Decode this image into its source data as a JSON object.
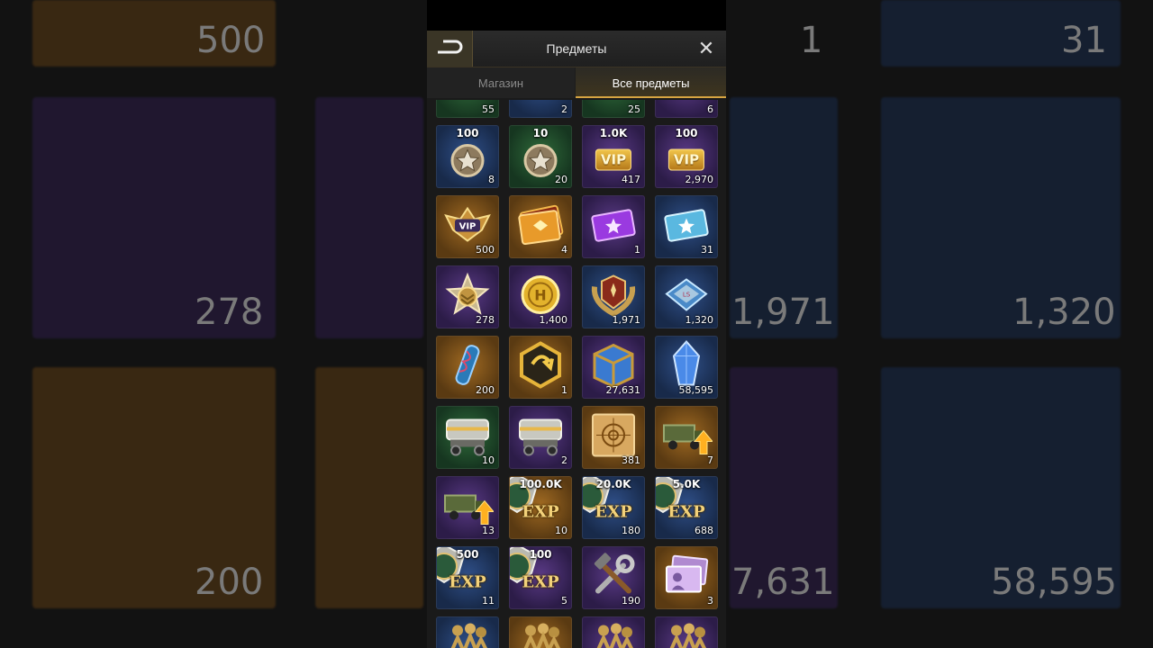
{
  "header": {
    "title": "Предметы",
    "back_icon": "back-arrow-icon",
    "close_icon": "close-icon"
  },
  "tabs": [
    {
      "label": "Магазин",
      "active": false
    },
    {
      "label": "Все предметы",
      "active": true
    }
  ],
  "colors": {
    "accent": "#d7a542",
    "rarity_green": "#2f6a3a",
    "rarity_blue": "#2f4f88",
    "rarity_purple": "#5a3a86",
    "rarity_orange": "#a06a22"
  },
  "partial_top_row": [
    {
      "count": "55",
      "rarity": "green"
    },
    {
      "count": "2",
      "rarity": "blue"
    },
    {
      "count": "25",
      "rarity": "green"
    },
    {
      "count": "6",
      "rarity": "purple"
    }
  ],
  "items": [
    {
      "icon": "star-medal-icon",
      "badge": "100",
      "count": "8",
      "rarity": "blue"
    },
    {
      "icon": "star-medal-icon",
      "badge": "10",
      "count": "20",
      "rarity": "green"
    },
    {
      "icon": "vip-card-icon",
      "badge": "1.0K",
      "label": "VIP",
      "count": "417",
      "rarity": "purple"
    },
    {
      "icon": "vip-card-icon",
      "badge": "100",
      "label": "VIP",
      "count": "2,970",
      "rarity": "purple"
    },
    {
      "icon": "vip-wings-badge-icon",
      "label": "VIP",
      "count": "500",
      "rarity": "orange"
    },
    {
      "icon": "gold-ticket-icon",
      "count": "4",
      "rarity": "orange"
    },
    {
      "icon": "purple-ticket-icon",
      "count": "1",
      "rarity": "purple"
    },
    {
      "icon": "blue-ticket-icon",
      "count": "31",
      "rarity": "blue"
    },
    {
      "icon": "rank-star-laurel-icon",
      "count": "278",
      "rarity": "purple"
    },
    {
      "icon": "gold-coin-icon",
      "count": "1,400",
      "rarity": "purple"
    },
    {
      "icon": "laurel-emblem-icon",
      "count": "1,971",
      "rarity": "blue"
    },
    {
      "icon": "blue-plate-icon",
      "count": "1,320",
      "rarity": "blue"
    },
    {
      "icon": "dna-tube-icon",
      "count": "200",
      "rarity": "orange"
    },
    {
      "icon": "hexagon-emblem-icon",
      "count": "1",
      "rarity": "orange"
    },
    {
      "icon": "blue-crate-icon",
      "count": "27,631",
      "rarity": "purple"
    },
    {
      "icon": "crystal-icon",
      "count": "58,595",
      "rarity": "blue"
    },
    {
      "icon": "supply-truck-icon",
      "count": "10",
      "rarity": "green"
    },
    {
      "icon": "supply-truck-icon",
      "count": "2",
      "rarity": "purple"
    },
    {
      "icon": "target-map-icon",
      "count": "381",
      "rarity": "orange"
    },
    {
      "icon": "truck-upgrade-icon",
      "count": "7",
      "rarity": "orange"
    },
    {
      "icon": "truck-upgrade-icon",
      "count": "13",
      "rarity": "purple"
    },
    {
      "icon": "exp-book-icon",
      "badge": "100.0K",
      "label": "EXP",
      "count": "10",
      "rarity": "orange"
    },
    {
      "icon": "exp-book-icon",
      "badge": "20.0K",
      "label": "EXP",
      "count": "180",
      "rarity": "blue"
    },
    {
      "icon": "exp-book-icon",
      "badge": "5.0K",
      "label": "EXP",
      "count": "688",
      "rarity": "blue"
    },
    {
      "icon": "exp-book-icon",
      "badge": "500",
      "label": "EXP",
      "count": "11",
      "rarity": "blue"
    },
    {
      "icon": "exp-book-icon",
      "badge": "100",
      "label": "EXP",
      "count": "5",
      "rarity": "purple"
    },
    {
      "icon": "wrench-hammer-icon",
      "count": "190",
      "rarity": "purple"
    },
    {
      "icon": "photo-cards-icon",
      "count": "3",
      "rarity": "orange"
    }
  ],
  "partial_bottom_row": [
    {
      "icon": "soldiers-icon",
      "rarity": "blue"
    },
    {
      "icon": "soldiers-icon",
      "rarity": "orange"
    },
    {
      "icon": "soldiers-icon",
      "rarity": "purple"
    },
    {
      "icon": "soldiers-icon",
      "rarity": "purple"
    }
  ],
  "background": {
    "counts": [
      "500",
      "1",
      "31",
      "278",
      "1,971",
      "1,320",
      "200",
      "7,631",
      "58,595"
    ]
  }
}
